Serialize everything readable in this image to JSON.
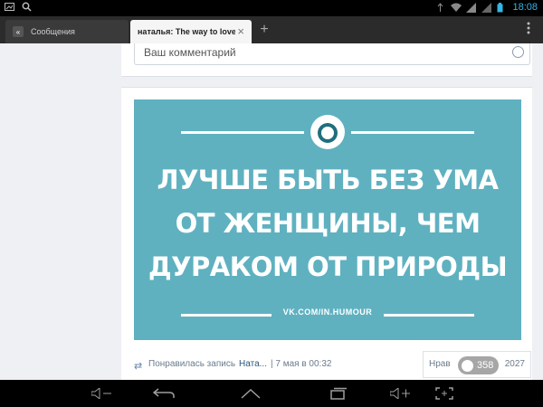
{
  "statusbar": {
    "time": "18:08"
  },
  "tabs": [
    {
      "label": "Сообщения",
      "active": false
    },
    {
      "label": "наталья: The way to love...",
      "active": true
    }
  ],
  "comment_box": {
    "placeholder": "Ваш комментарий"
  },
  "post": {
    "quote_lines": [
      "ЛУЧШЕ БЫТЬ БЕЗ УМА",
      "ОТ ЖЕНЩИНЫ, ЧЕМ",
      "ДУРАКОМ ОТ ПРИРОДЫ"
    ],
    "site": "VK.COM/IN.HUMOUR",
    "liked_text": "Понравилась запись",
    "liked_link": "Ната...",
    "timestamp": "| 7 мая в 00:32",
    "like_button": "Нрав",
    "like_count_partial": "2027"
  },
  "toast": {
    "count": "358"
  },
  "icons": {
    "tab_close": "×",
    "new_tab": "+",
    "menu": "⋮"
  },
  "colors": {
    "poster_bg": "#5fb1c0",
    "statusbar_accent": "#33b5e5"
  }
}
